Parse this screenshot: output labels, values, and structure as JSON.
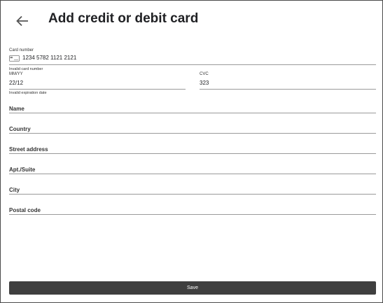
{
  "header": {
    "back_icon": "arrow-left-icon",
    "title": "Add credit or debit card"
  },
  "card_number": {
    "label": "Card number",
    "icon": "credit-card-icon",
    "value": "1234 5782 1121 2121",
    "error": "Invalid card number"
  },
  "expiry": {
    "label": "MM/YY",
    "value": "22/12",
    "error": "Invalid expiration date"
  },
  "cvc": {
    "label": "CVC",
    "value": "323"
  },
  "fields": {
    "name": "Name",
    "country": "Country",
    "street": "Street address",
    "apt": "Apt./Suite",
    "city": "City",
    "postal": "Postal code"
  },
  "save_label": "Save"
}
